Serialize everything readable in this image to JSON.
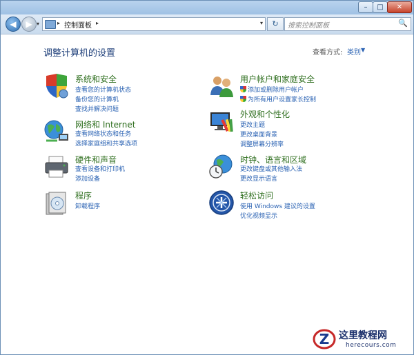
{
  "window": {
    "controls": {
      "minimize": "–",
      "maximize": "□",
      "close": "✕"
    }
  },
  "nav": {
    "back": "◀",
    "forward": "▶",
    "menu_caret": "▾",
    "address_crumb": "控制面板",
    "address_sep": "▸",
    "address_drop": "▾",
    "refresh": "↻",
    "search_placeholder": "搜索控制面板",
    "search_icon": "🔍"
  },
  "header": {
    "title": "调整计算机的设置",
    "view_by_label": "查看方式:",
    "view_by_value": "类别",
    "view_by_caret": "▼"
  },
  "categories": [
    {
      "title": "系统和安全",
      "icon": "system-security-icon",
      "links": [
        "查看您的计算机状态",
        "备份您的计算机",
        "查找并解决问题"
      ]
    },
    {
      "title": "网络和 Internet",
      "icon": "network-icon",
      "links": [
        "查看网络状态和任务",
        "选择家庭组和共享选项"
      ]
    },
    {
      "title": "硬件和声音",
      "icon": "hardware-printer-icon",
      "links": [
        "查看设备和打印机",
        "添加设备"
      ]
    },
    {
      "title": "程序",
      "icon": "programs-icon",
      "links": [
        "卸载程序"
      ]
    },
    {
      "title": "用户帐户和家庭安全",
      "icon": "user-accounts-icon",
      "links": [
        "添加或删除用户帐户",
        "为所有用户设置家长控制"
      ]
    },
    {
      "title": "外观和个性化",
      "icon": "appearance-icon",
      "links": [
        "更改主题",
        "更改桌面背景",
        "调整屏幕分辨率"
      ]
    },
    {
      "title": "时钟、语言和区域",
      "icon": "clock-globe-icon",
      "links": [
        "更改键盘或其他输入法",
        "更改显示语言"
      ]
    },
    {
      "title": "轻松访问",
      "icon": "ease-of-access-icon",
      "links": [
        "使用 Windows 建议的设置",
        "优化视频显示"
      ]
    }
  ],
  "watermark": {
    "name": "这里教程网",
    "url": "herecours.com",
    "logo_letter": "Z"
  },
  "colors": {
    "category_title": "#2f6f1f",
    "link": "#2a62b3",
    "heading": "#1e3f7a"
  }
}
